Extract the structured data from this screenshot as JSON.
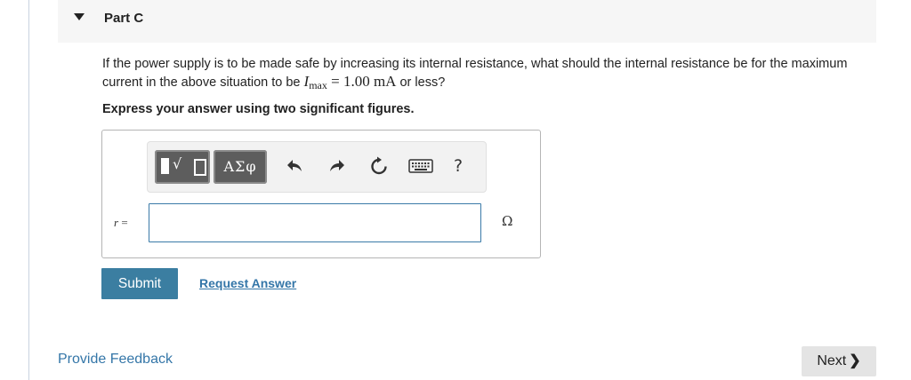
{
  "part": {
    "title": "Part C"
  },
  "question": {
    "text_before": "If the power supply is to be made safe by increasing its internal resistance, what should the internal resistance be for the maximum current in the above situation to be ",
    "math_var": "I",
    "math_sub": "max",
    "math_eq": " = 1.00 mA",
    "text_after": " or less?"
  },
  "instructions": "Express your answer using two significant figures.",
  "toolbar": {
    "greek_label": "ΑΣφ",
    "help_label": "?",
    "icons": [
      "templates-icon",
      "greek-letters-icon",
      "undo-icon",
      "redo-icon",
      "reset-icon",
      "keyboard-icon",
      "help-icon"
    ]
  },
  "answer": {
    "variable": "r",
    "equals": " =",
    "value": "",
    "unit": "Ω"
  },
  "actions": {
    "submit_label": "Submit",
    "request_answer_label": "Request Answer"
  },
  "footer": {
    "feedback_label": "Provide Feedback",
    "next_label": "Next",
    "next_chevron": "❯"
  },
  "colors": {
    "accent": "#3b7ea1",
    "link": "#3476a8",
    "header_bg": "#f6f6f6"
  }
}
